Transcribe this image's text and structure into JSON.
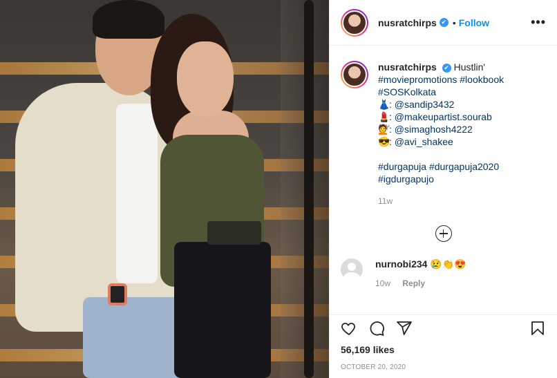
{
  "post": {
    "username": "nusratchirps",
    "verified_mark": "✔",
    "dot": "•",
    "follow_label": "Follow",
    "more_label": "•••"
  },
  "caption": {
    "username": "nusratchirps",
    "text": "Hustlin'",
    "line2": "#moviepromotions #lookbook",
    "line3": "#SOSKolkata",
    "credits": [
      {
        "emoji": "👗",
        "handle": "@sandip3432"
      },
      {
        "emoji": "💄",
        "handle": "@makeupartist.sourab"
      },
      {
        "emoji": "💇",
        "handle": "@simaghosh4222"
      },
      {
        "emoji": "😎",
        "handle": "@avi_shakee"
      }
    ],
    "hashtags1": "#durgapuja #durgapuja2020",
    "hashtags2": "#igdurgapujo",
    "time": "11w"
  },
  "comments": [
    {
      "username": "nurnobi234",
      "text": "😢👏😍",
      "time": "10w",
      "reply_label": "Reply"
    }
  ],
  "footer": {
    "likes": "56,169 likes",
    "date": "OCTOBER 20, 2020"
  },
  "icons": [
    "more-options-icon",
    "heart-icon",
    "comment-icon",
    "share-icon",
    "bookmark-icon",
    "load-more-icon"
  ],
  "colors": {
    "link": "#0095f6",
    "hashtag": "#00376b",
    "meta": "#8e8e8e",
    "verified": "#3897f0"
  }
}
